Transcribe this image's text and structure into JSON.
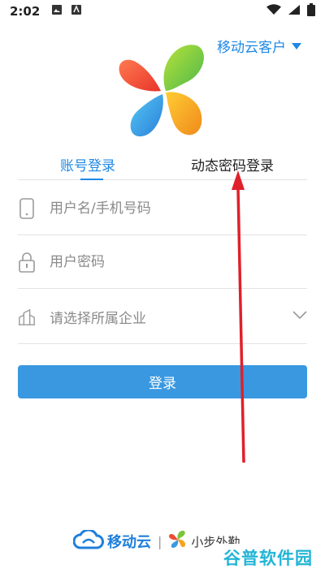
{
  "status_bar": {
    "time": "2:02"
  },
  "header": {
    "account_type_label": "移动云客户"
  },
  "tabs": [
    {
      "label": "账号登录",
      "active": true
    },
    {
      "label": "动态密码登录",
      "active": false
    }
  ],
  "form": {
    "username_placeholder": "用户名/手机号码",
    "password_placeholder": "用户密码",
    "company_placeholder": "请选择所属企业"
  },
  "login_button": {
    "label": "登录"
  },
  "footer": {
    "brand1": "移动云",
    "brand2": "小步外勤"
  },
  "watermark": {
    "text": "谷普软件园"
  },
  "colors": {
    "accent": "#1e88e5",
    "button": "#3a98e1",
    "arrow": "#e0202a"
  }
}
